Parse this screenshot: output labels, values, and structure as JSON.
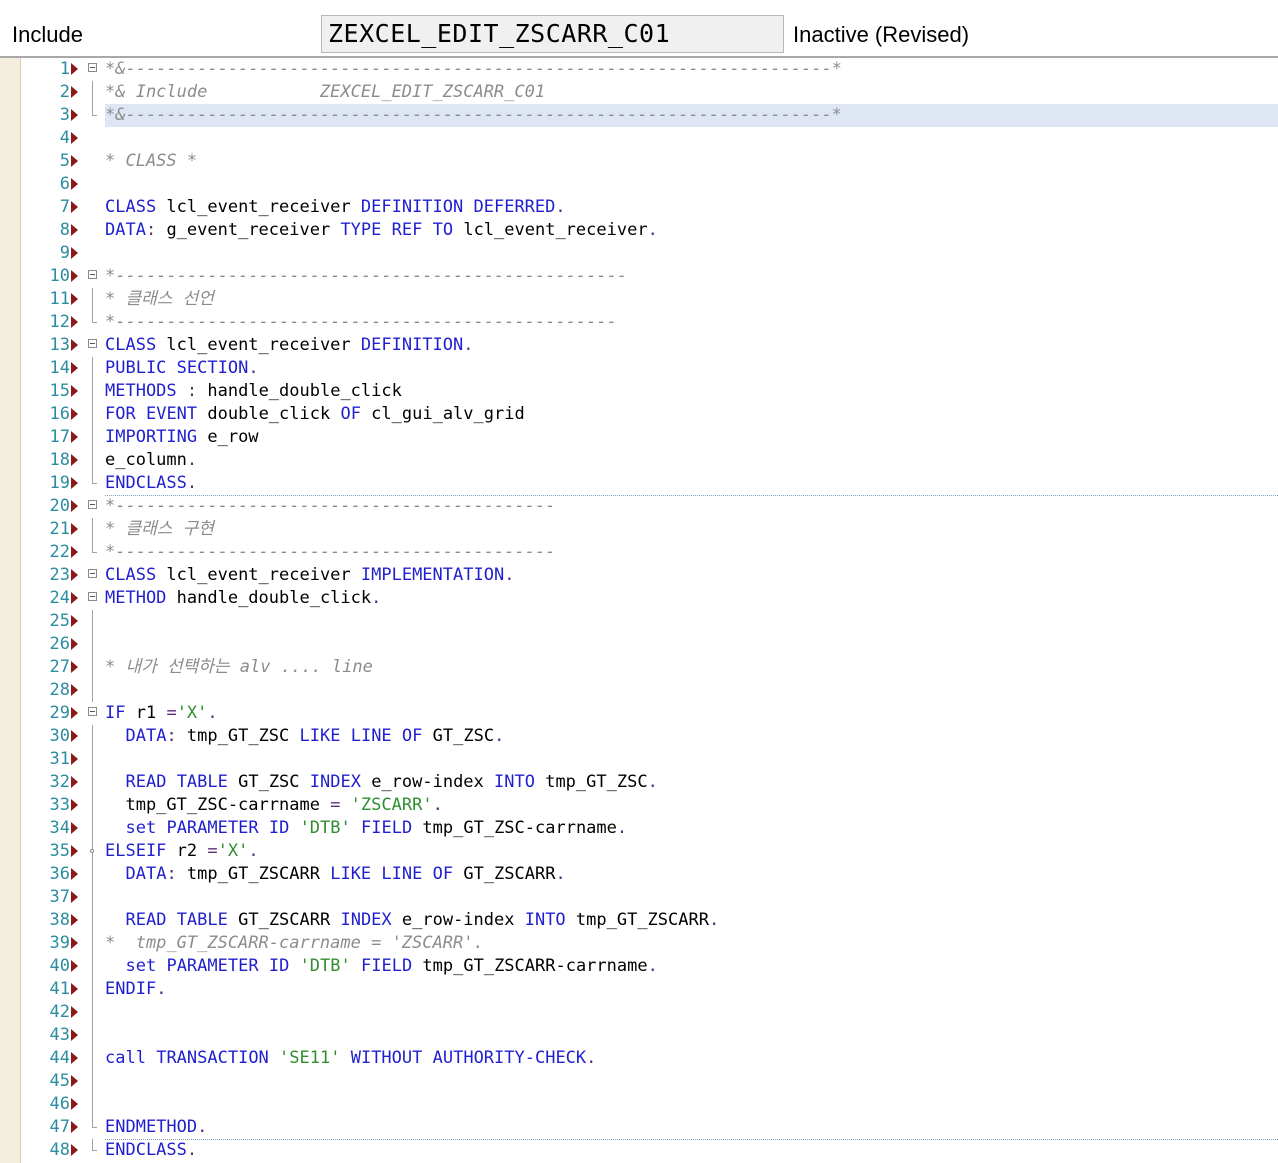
{
  "header": {
    "label": "Include",
    "program_name": "ZEXCEL_EDIT_ZSCARR_C01",
    "status": "Inactive (Revised)"
  },
  "colors": {
    "keyword": "#1f1fcf",
    "comment": "#8c8c8c",
    "string": "#2f8f2f",
    "line_number": "#2b8da0",
    "marker": "#8b1a1a",
    "highlight": "#dde6f2"
  },
  "lines": [
    {
      "n": "1",
      "tokens": [
        {
          "t": "*&---------------------------------------------------------------------*",
          "c": "cm"
        }
      ]
    },
    {
      "n": "2",
      "tokens": [
        {
          "t": "*& Include           ZEXCEL_EDIT_ZSCARR_C01",
          "c": "cm"
        }
      ]
    },
    {
      "n": "3",
      "tokens": [
        {
          "t": "*&---------------------------------------------------------------------*",
          "c": "cm"
        }
      ]
    },
    {
      "n": "4",
      "tokens": []
    },
    {
      "n": "5",
      "tokens": [
        {
          "t": "* CLASS *",
          "c": "cm"
        }
      ]
    },
    {
      "n": "6",
      "tokens": []
    },
    {
      "n": "7",
      "tokens": [
        {
          "t": "CLASS",
          "c": "kw"
        },
        {
          "t": " lcl_event_receiver ",
          "c": ""
        },
        {
          "t": "DEFINITION",
          "c": "kw"
        },
        {
          "t": " ",
          "c": ""
        },
        {
          "t": "DEFERRED",
          "c": "kw"
        },
        {
          "t": ".",
          "c": "pn"
        }
      ]
    },
    {
      "n": "8",
      "tokens": [
        {
          "t": "DATA",
          "c": "kw"
        },
        {
          "t": ":",
          "c": "pn"
        },
        {
          "t": " g_event_receiver ",
          "c": ""
        },
        {
          "t": "TYPE",
          "c": "kw"
        },
        {
          "t": " ",
          "c": ""
        },
        {
          "t": "REF",
          "c": "kw"
        },
        {
          "t": " ",
          "c": ""
        },
        {
          "t": "TO",
          "c": "kw"
        },
        {
          "t": " lcl_event_receiver",
          "c": ""
        },
        {
          "t": ".",
          "c": "pn"
        }
      ]
    },
    {
      "n": "9",
      "tokens": []
    },
    {
      "n": "10",
      "tokens": [
        {
          "t": "*--------------------------------------------------",
          "c": "cm"
        }
      ]
    },
    {
      "n": "11",
      "tokens": [
        {
          "t": "* 클래스 선언",
          "c": "cm"
        }
      ]
    },
    {
      "n": "12",
      "tokens": [
        {
          "t": "*-------------------------------------------------",
          "c": "cm"
        }
      ]
    },
    {
      "n": "13",
      "tokens": [
        {
          "t": "CLASS",
          "c": "kw"
        },
        {
          "t": " lcl_event_receiver ",
          "c": ""
        },
        {
          "t": "DEFINITION",
          "c": "kw"
        },
        {
          "t": ".",
          "c": "pn"
        }
      ]
    },
    {
      "n": "14",
      "tokens": [
        {
          "t": "PUBLIC",
          "c": "kw"
        },
        {
          "t": " ",
          "c": ""
        },
        {
          "t": "SECTION",
          "c": "kw"
        },
        {
          "t": ".",
          "c": "pn"
        }
      ]
    },
    {
      "n": "15",
      "tokens": [
        {
          "t": "METHODS",
          "c": "kw"
        },
        {
          "t": " ",
          "c": ""
        },
        {
          "t": ":",
          "c": "pn"
        },
        {
          "t": " handle_double_click",
          "c": ""
        }
      ]
    },
    {
      "n": "16",
      "tokens": [
        {
          "t": "FOR",
          "c": "kw"
        },
        {
          "t": " ",
          "c": ""
        },
        {
          "t": "EVENT",
          "c": "kw"
        },
        {
          "t": " double_click ",
          "c": ""
        },
        {
          "t": "OF",
          "c": "kw"
        },
        {
          "t": " cl_gui_alv_grid",
          "c": ""
        }
      ]
    },
    {
      "n": "17",
      "tokens": [
        {
          "t": "IMPORTING",
          "c": "kw"
        },
        {
          "t": " e_row",
          "c": ""
        }
      ]
    },
    {
      "n": "18",
      "tokens": [
        {
          "t": "e_column",
          "c": ""
        },
        {
          "t": ".",
          "c": "pn"
        }
      ]
    },
    {
      "n": "19",
      "tokens": [
        {
          "t": "ENDCLASS",
          "c": "kw"
        },
        {
          "t": ".",
          "c": "pn"
        }
      ]
    },
    {
      "n": "20",
      "tokens": [
        {
          "t": "*-------------------------------------------",
          "c": "cm"
        }
      ]
    },
    {
      "n": "21",
      "tokens": [
        {
          "t": "* 클래스 구현",
          "c": "cm"
        }
      ]
    },
    {
      "n": "22",
      "tokens": [
        {
          "t": "*-------------------------------------------",
          "c": "cm"
        }
      ]
    },
    {
      "n": "23",
      "tokens": [
        {
          "t": "CLASS",
          "c": "kw"
        },
        {
          "t": " lcl_event_receiver ",
          "c": ""
        },
        {
          "t": "IMPLEMENTATION",
          "c": "kw"
        },
        {
          "t": ".",
          "c": "pn"
        }
      ]
    },
    {
      "n": "24",
      "tokens": [
        {
          "t": "METHOD",
          "c": "kw"
        },
        {
          "t": " handle_double_click",
          "c": ""
        },
        {
          "t": ".",
          "c": "pn"
        }
      ]
    },
    {
      "n": "25",
      "tokens": []
    },
    {
      "n": "26",
      "tokens": []
    },
    {
      "n": "27",
      "tokens": [
        {
          "t": "* 내가 선택하는 alv .... line",
          "c": "cm"
        }
      ]
    },
    {
      "n": "28",
      "tokens": []
    },
    {
      "n": "29",
      "tokens": [
        {
          "t": "IF",
          "c": "kw"
        },
        {
          "t": " r1 ",
          "c": ""
        },
        {
          "t": "=",
          "c": "pn"
        },
        {
          "t": "'X'",
          "c": "st"
        },
        {
          "t": ".",
          "c": "pn"
        }
      ]
    },
    {
      "n": "30",
      "tokens": [
        {
          "t": "  ",
          "c": ""
        },
        {
          "t": "DATA",
          "c": "kw"
        },
        {
          "t": ":",
          "c": "pn"
        },
        {
          "t": " tmp_GT_ZSC ",
          "c": ""
        },
        {
          "t": "LIKE",
          "c": "kw"
        },
        {
          "t": " ",
          "c": ""
        },
        {
          "t": "LINE",
          "c": "kw"
        },
        {
          "t": " ",
          "c": ""
        },
        {
          "t": "OF",
          "c": "kw"
        },
        {
          "t": " GT_ZSC",
          "c": ""
        },
        {
          "t": ".",
          "c": "pn"
        }
      ]
    },
    {
      "n": "31",
      "tokens": []
    },
    {
      "n": "32",
      "tokens": [
        {
          "t": "  ",
          "c": ""
        },
        {
          "t": "READ",
          "c": "kw"
        },
        {
          "t": " ",
          "c": ""
        },
        {
          "t": "TABLE",
          "c": "kw"
        },
        {
          "t": " GT_ZSC ",
          "c": ""
        },
        {
          "t": "INDEX",
          "c": "kw"
        },
        {
          "t": " e_row-index ",
          "c": ""
        },
        {
          "t": "INTO",
          "c": "kw"
        },
        {
          "t": " tmp_GT_ZSC",
          "c": ""
        },
        {
          "t": ".",
          "c": "pn"
        }
      ]
    },
    {
      "n": "33",
      "tokens": [
        {
          "t": "  tmp_GT_ZSC-carrname ",
          "c": ""
        },
        {
          "t": "=",
          "c": "pn"
        },
        {
          "t": " ",
          "c": ""
        },
        {
          "t": "'ZSCARR'",
          "c": "st"
        },
        {
          "t": ".",
          "c": "pn"
        }
      ]
    },
    {
      "n": "34",
      "tokens": [
        {
          "t": "  ",
          "c": ""
        },
        {
          "t": "set",
          "c": "kw"
        },
        {
          "t": " ",
          "c": ""
        },
        {
          "t": "PARAMETER",
          "c": "kw"
        },
        {
          "t": " ",
          "c": ""
        },
        {
          "t": "ID",
          "c": "kw"
        },
        {
          "t": " ",
          "c": ""
        },
        {
          "t": "'DTB'",
          "c": "st"
        },
        {
          "t": " ",
          "c": ""
        },
        {
          "t": "FIELD",
          "c": "kw"
        },
        {
          "t": " tmp_GT_ZSC-carrname",
          "c": ""
        },
        {
          "t": ".",
          "c": "pn"
        }
      ]
    },
    {
      "n": "35",
      "tokens": [
        {
          "t": "ELSEIF",
          "c": "kw"
        },
        {
          "t": " r2 ",
          "c": ""
        },
        {
          "t": "=",
          "c": "pn"
        },
        {
          "t": "'X'",
          "c": "st"
        },
        {
          "t": ".",
          "c": "pn"
        }
      ]
    },
    {
      "n": "36",
      "tokens": [
        {
          "t": "  ",
          "c": ""
        },
        {
          "t": "DATA",
          "c": "kw"
        },
        {
          "t": ":",
          "c": "pn"
        },
        {
          "t": " tmp_GT_ZSCARR ",
          "c": ""
        },
        {
          "t": "LIKE",
          "c": "kw"
        },
        {
          "t": " ",
          "c": ""
        },
        {
          "t": "LINE",
          "c": "kw"
        },
        {
          "t": " ",
          "c": ""
        },
        {
          "t": "OF",
          "c": "kw"
        },
        {
          "t": " GT_ZSCARR",
          "c": ""
        },
        {
          "t": ".",
          "c": "pn"
        }
      ]
    },
    {
      "n": "37",
      "tokens": []
    },
    {
      "n": "38",
      "tokens": [
        {
          "t": "  ",
          "c": ""
        },
        {
          "t": "READ",
          "c": "kw"
        },
        {
          "t": " ",
          "c": ""
        },
        {
          "t": "TABLE",
          "c": "kw"
        },
        {
          "t": " GT_ZSCARR ",
          "c": ""
        },
        {
          "t": "INDEX",
          "c": "kw"
        },
        {
          "t": " e_row-index ",
          "c": ""
        },
        {
          "t": "INTO",
          "c": "kw"
        },
        {
          "t": " tmp_GT_ZSCARR",
          "c": ""
        },
        {
          "t": ".",
          "c": "pn"
        }
      ]
    },
    {
      "n": "39",
      "tokens": [
        {
          "t": "*  tmp_GT_ZSCARR-carrname = 'ZSCARR'.",
          "c": "cm"
        }
      ]
    },
    {
      "n": "40",
      "tokens": [
        {
          "t": "  ",
          "c": ""
        },
        {
          "t": "set",
          "c": "kw"
        },
        {
          "t": " ",
          "c": ""
        },
        {
          "t": "PARAMETER",
          "c": "kw"
        },
        {
          "t": " ",
          "c": ""
        },
        {
          "t": "ID",
          "c": "kw"
        },
        {
          "t": " ",
          "c": ""
        },
        {
          "t": "'DTB'",
          "c": "st"
        },
        {
          "t": " ",
          "c": ""
        },
        {
          "t": "FIELD",
          "c": "kw"
        },
        {
          "t": " tmp_GT_ZSCARR-carrname",
          "c": ""
        },
        {
          "t": ".",
          "c": "pn"
        }
      ]
    },
    {
      "n": "41",
      "tokens": [
        {
          "t": "ENDIF",
          "c": "kw"
        },
        {
          "t": ".",
          "c": "pn"
        }
      ]
    },
    {
      "n": "42",
      "tokens": []
    },
    {
      "n": "43",
      "tokens": []
    },
    {
      "n": "44",
      "tokens": [
        {
          "t": "call",
          "c": "kw"
        },
        {
          "t": " ",
          "c": ""
        },
        {
          "t": "TRANSACTION",
          "c": "kw"
        },
        {
          "t": " ",
          "c": ""
        },
        {
          "t": "'SE11'",
          "c": "st"
        },
        {
          "t": " ",
          "c": ""
        },
        {
          "t": "WITHOUT",
          "c": "kw"
        },
        {
          "t": " ",
          "c": ""
        },
        {
          "t": "AUTHORITY-CHECK",
          "c": "kw"
        },
        {
          "t": ".",
          "c": "pn"
        }
      ]
    },
    {
      "n": "45",
      "tokens": []
    },
    {
      "n": "46",
      "tokens": []
    },
    {
      "n": "47",
      "tokens": [
        {
          "t": "ENDMETHOD",
          "c": "kw"
        },
        {
          "t": ".",
          "c": "pn"
        }
      ]
    },
    {
      "n": "48",
      "tokens": [
        {
          "t": "ENDCLASS",
          "c": "kw"
        },
        {
          "t": ".",
          "c": "pn"
        }
      ]
    }
  ]
}
